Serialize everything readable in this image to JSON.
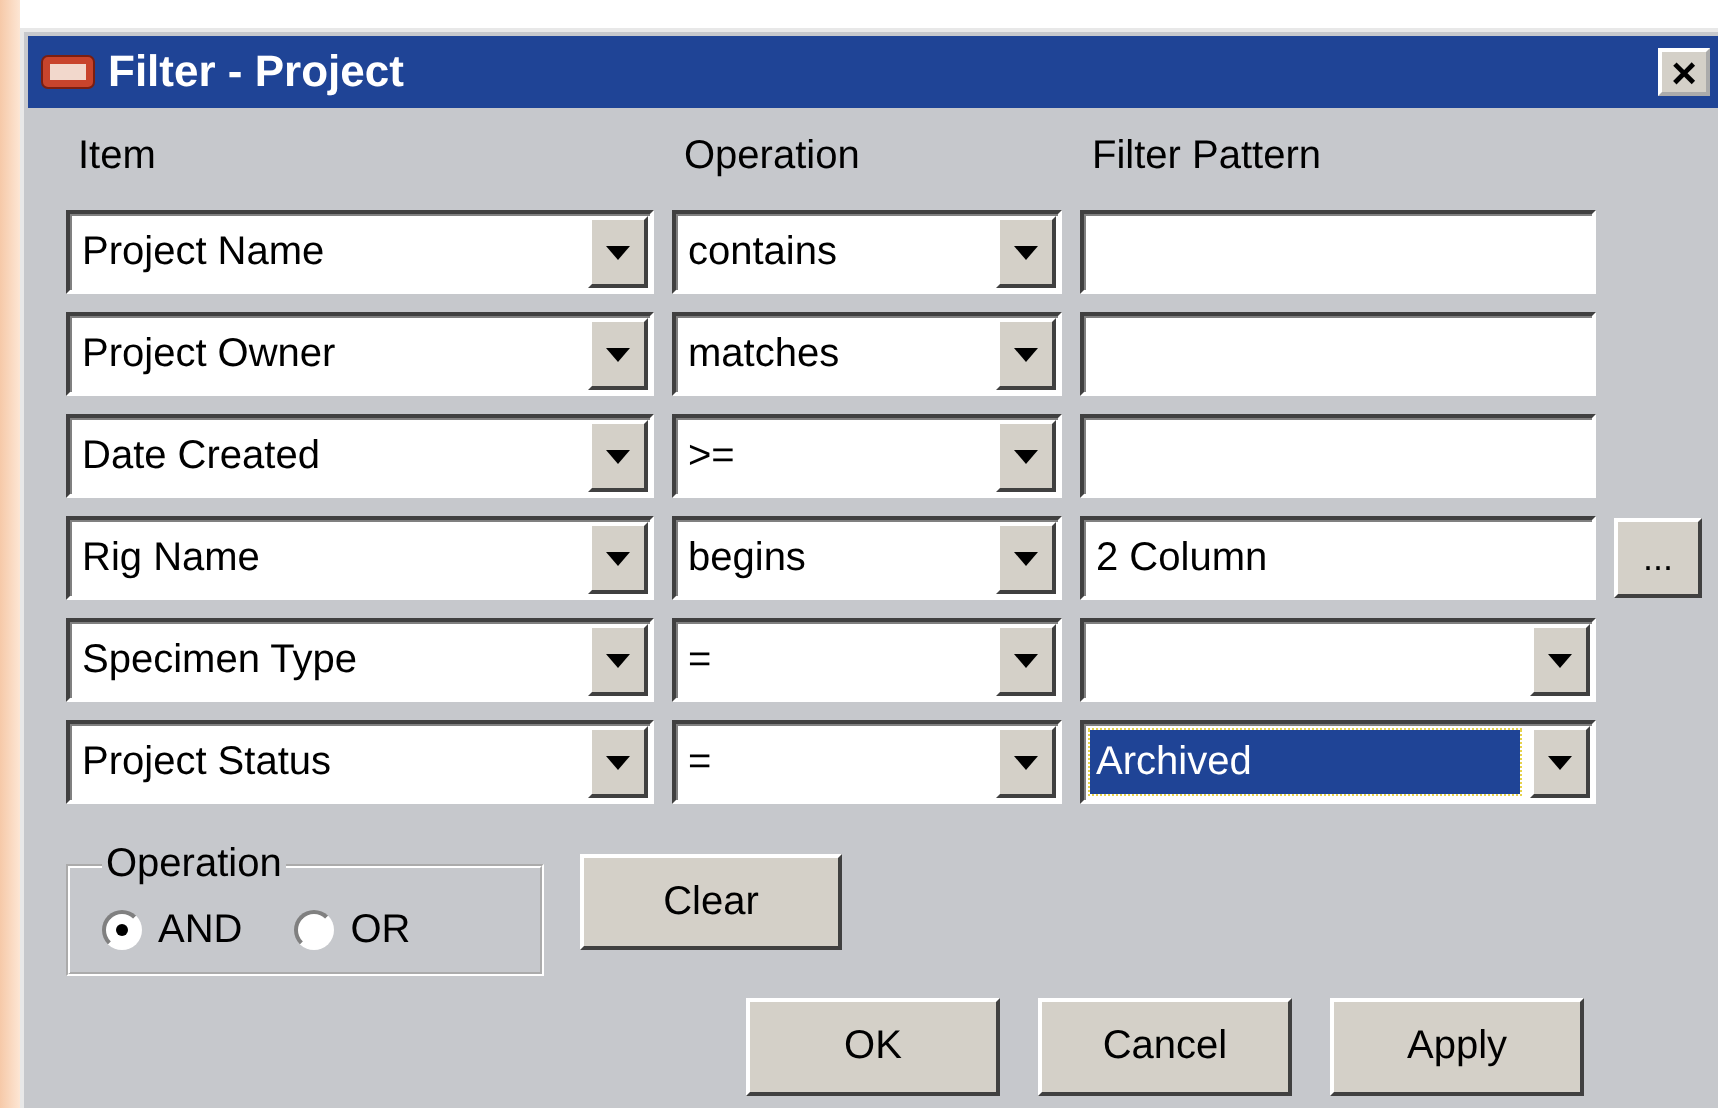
{
  "window": {
    "title": "Filter - Project",
    "close": "×"
  },
  "columns": [
    "Item",
    "Operation",
    "Filter Pattern"
  ],
  "rows": [
    {
      "item": "Project Name",
      "operation": "contains",
      "pattern": {
        "kind": "text",
        "selected": false
      }
    },
    {
      "item": "Project Owner",
      "operation": "matches",
      "pattern": {
        "kind": "text",
        "selected": false
      }
    },
    {
      "item": "Date Created",
      "operation": ">=",
      "pattern": {
        "kind": "text",
        "selected": false
      }
    },
    {
      "item": "Rig Name",
      "operation": "begins",
      "pattern": {
        "kind": "text",
        "value": "2 Column",
        "selected": false
      },
      "browse_button": "..."
    },
    {
      "item": "Specimen Type",
      "operation": "=",
      "pattern": {
        "kind": "combo",
        "selected": false
      }
    },
    {
      "item": "Project Status",
      "operation": "=",
      "pattern": {
        "kind": "combo",
        "value": "Archived",
        "selected": true
      }
    }
  ],
  "operation_group": {
    "title": "Operation",
    "options": [
      {
        "label": "AND",
        "selected": true
      },
      {
        "label": "OR",
        "selected": false
      }
    ]
  },
  "clear_button": "Clear",
  "buttons": [
    "OK",
    "Cancel",
    "Apply"
  ]
}
